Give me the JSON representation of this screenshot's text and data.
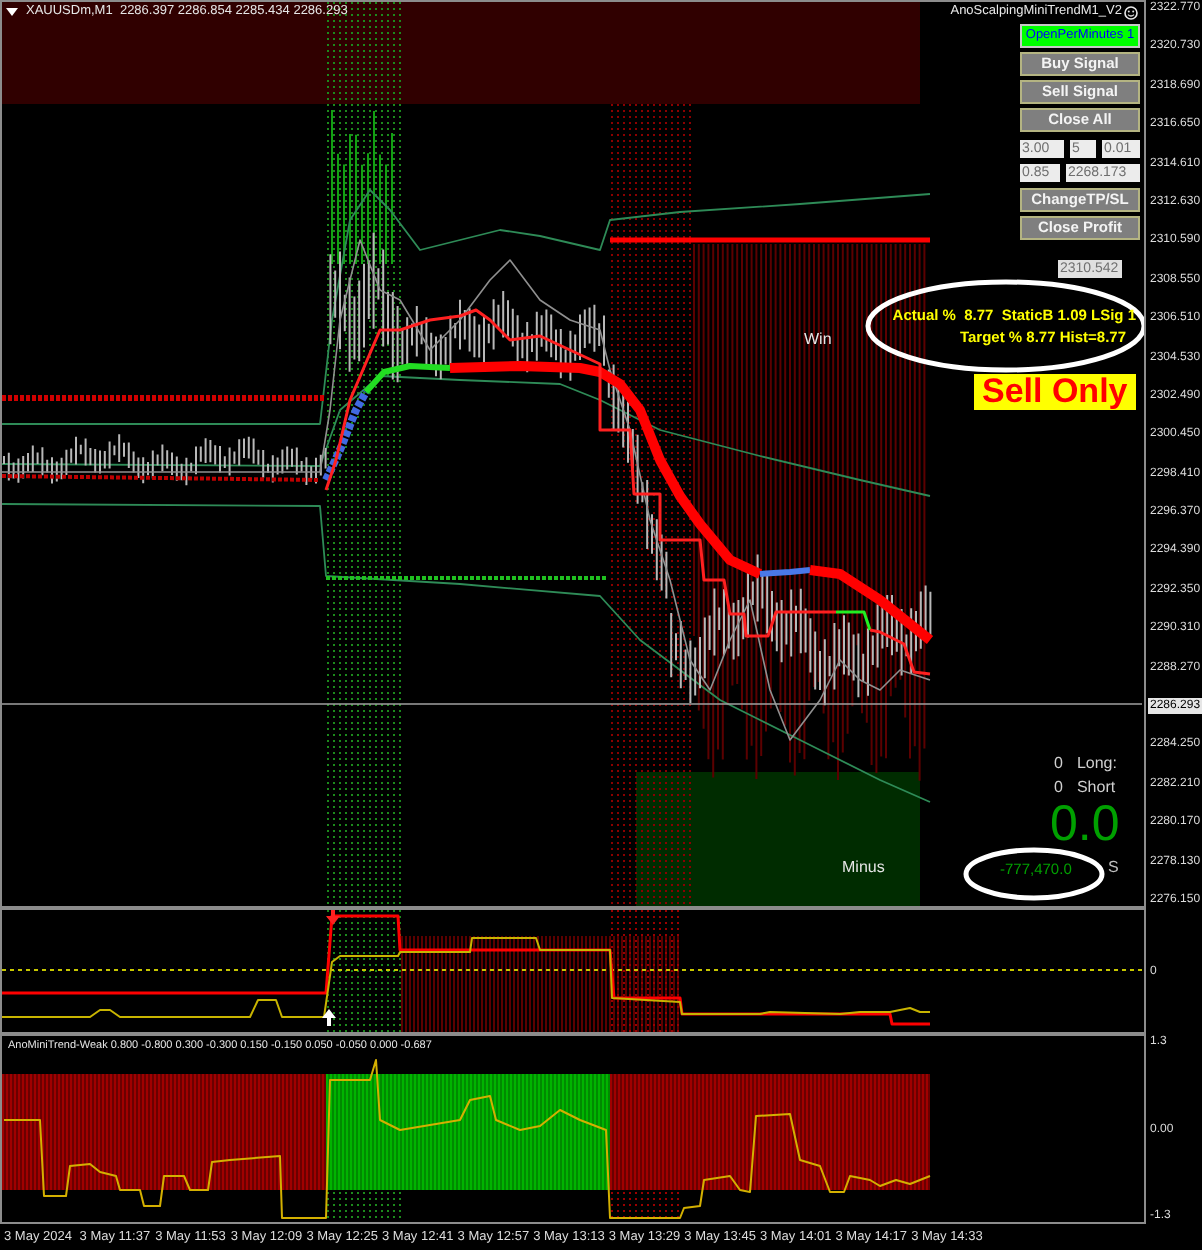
{
  "chart_header": {
    "text": "XAUUSDm,M1  2286.397 2286.854 2285.434 2286.293"
  },
  "expert": {
    "name": "AnoScalpingMiniTrendM1_V2"
  },
  "control_panel": {
    "buttons": [
      {
        "label": "OpenPerMinutes 1",
        "on": true
      },
      {
        "label": "Buy Signal",
        "on": false
      },
      {
        "label": "Sell Signal",
        "on": false
      },
      {
        "label": "Close All",
        "on": false
      }
    ],
    "input_rows": [
      [
        {
          "value": "3.00"
        },
        {
          "value": "5"
        },
        {
          "value": "0.01"
        }
      ],
      [
        {
          "value": "0.85"
        },
        {
          "value": "2268.173"
        }
      ]
    ],
    "lower_buttons": [
      {
        "label": "ChangeTP/SL"
      },
      {
        "label": "Close Profit"
      }
    ]
  },
  "price_tag": "2310.542",
  "stats": {
    "actual": "Actual %  8.77  StaticB 1.09 LSig 1",
    "target": "Target % 8.77 Hist=8.77"
  },
  "mode_banner": "Sell Only",
  "win_label": "Win",
  "minus_label": "Minus",
  "positions": [
    {
      "count": "0",
      "label": "Long:"
    },
    {
      "count": "0",
      "label": "Short"
    }
  ],
  "profit": {
    "value": "0.0",
    "total": "-777,470.0",
    "suffix": "S"
  },
  "price_axis": [
    {
      "label": "2322.770",
      "kind": "tick"
    },
    {
      "label": "2320.730",
      "kind": "tick"
    },
    {
      "label": "2318.690",
      "kind": "tick"
    },
    {
      "label": "2316.650",
      "kind": "tick"
    },
    {
      "label": "2314.610",
      "kind": "tick"
    },
    {
      "label": "2312.630",
      "kind": "tick"
    },
    {
      "label": "2310.590",
      "kind": "tick"
    },
    {
      "label": "2308.550",
      "kind": "tick"
    },
    {
      "label": "2306.510",
      "kind": "tick"
    },
    {
      "label": "2304.530",
      "kind": "tick"
    },
    {
      "label": "2302.490",
      "kind": "tick"
    },
    {
      "label": "2300.450",
      "kind": "tick"
    },
    {
      "label": "2298.410",
      "kind": "tick"
    },
    {
      "label": "2296.370",
      "kind": "tick"
    },
    {
      "label": "2294.390",
      "kind": "tick"
    },
    {
      "label": "2292.350",
      "kind": "tick"
    },
    {
      "label": "2290.310",
      "kind": "tick"
    },
    {
      "label": "2288.270",
      "kind": "tick"
    },
    {
      "label": "2286.293",
      "kind": "current"
    },
    {
      "label": "2284.250",
      "kind": "tick"
    },
    {
      "label": "2282.210",
      "kind": "tick"
    },
    {
      "label": "2280.170",
      "kind": "tick"
    },
    {
      "label": "2278.130",
      "kind": "tick"
    },
    {
      "label": "2276.150",
      "kind": "tick"
    }
  ],
  "subwindow_1": {
    "axis": [
      "0"
    ]
  },
  "subwindow_2": {
    "title": "AnoMiniTrend-Weak 0.800 -0.800 0.300 -0.300 0.150 -0.150 0.050 -0.050 0.000 -0.687",
    "axis": [
      "1.3",
      "0.00",
      "-1.3"
    ]
  },
  "time_axis": [
    "3 May 2024",
    "3 May 11:37",
    "3 May 11:53",
    "3 May 12:09",
    "3 May 12:25",
    "3 May 12:41",
    "3 May 12:57",
    "3 May 13:13",
    "3 May 13:29",
    "3 May 13:45",
    "3 May 14:01",
    "3 May 14:17",
    "3 May 14:33"
  ]
}
